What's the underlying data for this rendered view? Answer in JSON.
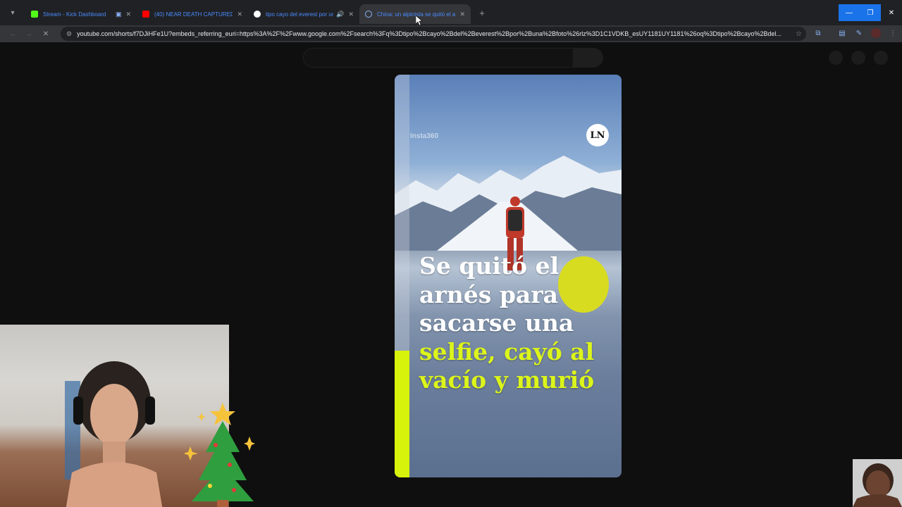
{
  "browser": {
    "tabs": [
      {
        "title": "Stream - Kick Dashboard",
        "favicon_color": "#53fc18",
        "active": false,
        "audio": false
      },
      {
        "title": "(40) NEAR DEATH CAPTURED b",
        "favicon_color": "#ff0000",
        "active": false,
        "audio": false
      },
      {
        "title": "tipo cayo del everest por un",
        "favicon_color": "#ffffff",
        "active": false,
        "audio": true
      },
      {
        "title": "China: un alpinista se quitó el a",
        "favicon_color": "#8ab4f8",
        "active": true,
        "audio": false
      }
    ],
    "new_tab_icon": "plus-icon",
    "url": "youtube.com/shorts/f7DJiHFe1U?embeds_referring_euri=https%3A%2F%2Fwww.google.com%2Fsearch%3Fq%3Dtipo%2Bcayo%2Bdel%2Beverest%2Bpor%2Buna%2Bfoto%26rlz%3D1C1VDKB_esUY1181UY1181%26oq%3Dtipo%2Bcayo%2Bdel..."
  },
  "short": {
    "watermark": "Insta360",
    "logo": "LN",
    "headline_white": [
      "Se quitó el",
      "arnés para",
      "sacarse una"
    ],
    "headline_yellow": [
      "selfie, cayó al",
      "vacío y murió"
    ],
    "accent_color": "#d7f20b"
  }
}
